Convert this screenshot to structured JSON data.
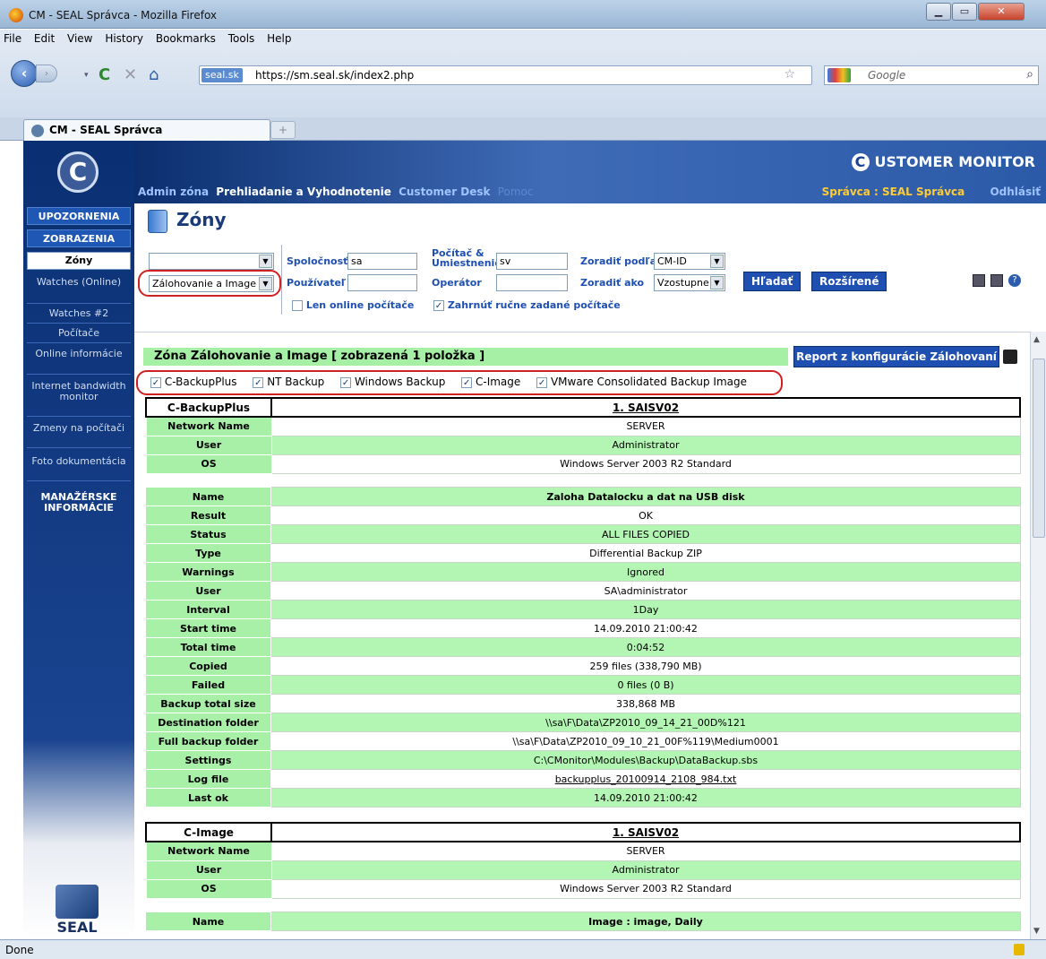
{
  "window": {
    "title": "CM - SEAL Správca - Mozilla Firefox"
  },
  "menu": [
    "File",
    "Edit",
    "View",
    "History",
    "Bookmarks",
    "Tools",
    "Help"
  ],
  "nav": {
    "identity": "seal.sk",
    "url": "https://sm.seal.sk/index2.php",
    "search_placeholder": "Google"
  },
  "tab": {
    "label": "CM - SEAL Správca"
  },
  "header": {
    "brand": "USTOMER MONITOR",
    "brand_c": "C",
    "nav": [
      "Admin zóna",
      "Prehliadanie a Vyhodnotenie",
      "Customer Desk",
      "Pomoc"
    ],
    "user_label": "Správca : SEAL Správca",
    "logout": "Odhlásiť"
  },
  "sidebar": {
    "logo": "C",
    "heads": [
      "UPOZORNENIA",
      "ZOBRAZENIA"
    ],
    "items": [
      "Zóny",
      "Watches (Online)",
      "Watches #2",
      "Počítače",
      "Online informácie",
      "Internet bandwidth monitor",
      "Zmeny na počítači",
      "Foto dokumentácia"
    ],
    "mgmt": "MANAŽÉRSKE INFORMÁCIE",
    "seal": "SEAL"
  },
  "page": {
    "title": "Zóny"
  },
  "filters": {
    "zone_select": "",
    "type_select": "Zálohovanie a Image",
    "company_label": "Spoločnosť",
    "company_value": "sa",
    "user_label": "Používateľ",
    "user_value": "",
    "pc_label": "Počítač & Umiestnenie",
    "pc_value": "sv",
    "operator_label": "Operátor",
    "operator_value": "",
    "sort_by_label": "Zoradiť podľa",
    "sort_by_value": "CM-ID",
    "sort_how_label": "Zoradiť ako",
    "sort_how_value": "Vzostupne",
    "search_btn": "Hľadať",
    "advanced_btn": "Rozšírené",
    "online_only": "Len online počítače",
    "include_manual": "Zahrnúť ručne zadané počítače"
  },
  "zone": {
    "title_prefix": "Zóna Zálohovanie a Image [ zobrazená ",
    "count": "1",
    "title_suffix": " položka ]",
    "report_btn": "Report z konfigurácie Zálohovaní",
    "toggles": [
      "C-BackupPlus",
      "NT Backup",
      "Windows Backup",
      "C-Image",
      "VMware Consolidated Backup Image"
    ]
  },
  "backupplus": {
    "section": "C-BackupPlus",
    "computer": "1. SAISV02",
    "info": [
      {
        "k": "Network Name",
        "v": "SERVER"
      },
      {
        "k": "User",
        "v": "Administrator"
      },
      {
        "k": "OS",
        "v": "Windows Server 2003 R2 Standard"
      }
    ],
    "details": [
      {
        "k": "Name",
        "v": "Zaloha Datalocku a dat na USB disk"
      },
      {
        "k": "Result",
        "v": "OK"
      },
      {
        "k": "Status",
        "v": "ALL FILES COPIED"
      },
      {
        "k": "Type",
        "v": "Differential Backup ZIP"
      },
      {
        "k": "Warnings",
        "v": "Ignored"
      },
      {
        "k": "User",
        "v": "SA\\administrator"
      },
      {
        "k": "Interval",
        "v": "1Day"
      },
      {
        "k": "Start time",
        "v": "14.09.2010 21:00:42"
      },
      {
        "k": "Total time",
        "v": "0:04:52"
      },
      {
        "k": "Copied",
        "v": "259 files (338,790 MB)"
      },
      {
        "k": "Failed",
        "v": "0 files (0 B)"
      },
      {
        "k": "Backup total size",
        "v": "338,868 MB"
      },
      {
        "k": "Destination folder",
        "v": "\\\\sa\\F\\Data\\ZP2010_09_14_21_00D%121"
      },
      {
        "k": "Full backup folder",
        "v": "\\\\sa\\F\\Data\\ZP2010_09_10_21_00F%119\\Medium0001"
      },
      {
        "k": "Settings",
        "v": "C:\\CMonitor\\Modules\\Backup\\DataBackup.sbs"
      },
      {
        "k": "Log file",
        "v": "backupplus_20100914_2108_984.txt"
      },
      {
        "k": "Last ok",
        "v": "14.09.2010 21:00:42"
      }
    ]
  },
  "cimage": {
    "section": "C-Image",
    "computer": "1. SAISV02",
    "info": [
      {
        "k": "Network Name",
        "v": "SERVER"
      },
      {
        "k": "User",
        "v": "Administrator"
      },
      {
        "k": "OS",
        "v": "Windows Server 2003 R2 Standard"
      }
    ],
    "details": [
      {
        "k": "Name",
        "v": "Image : image, Daily"
      }
    ]
  },
  "status": "Done"
}
